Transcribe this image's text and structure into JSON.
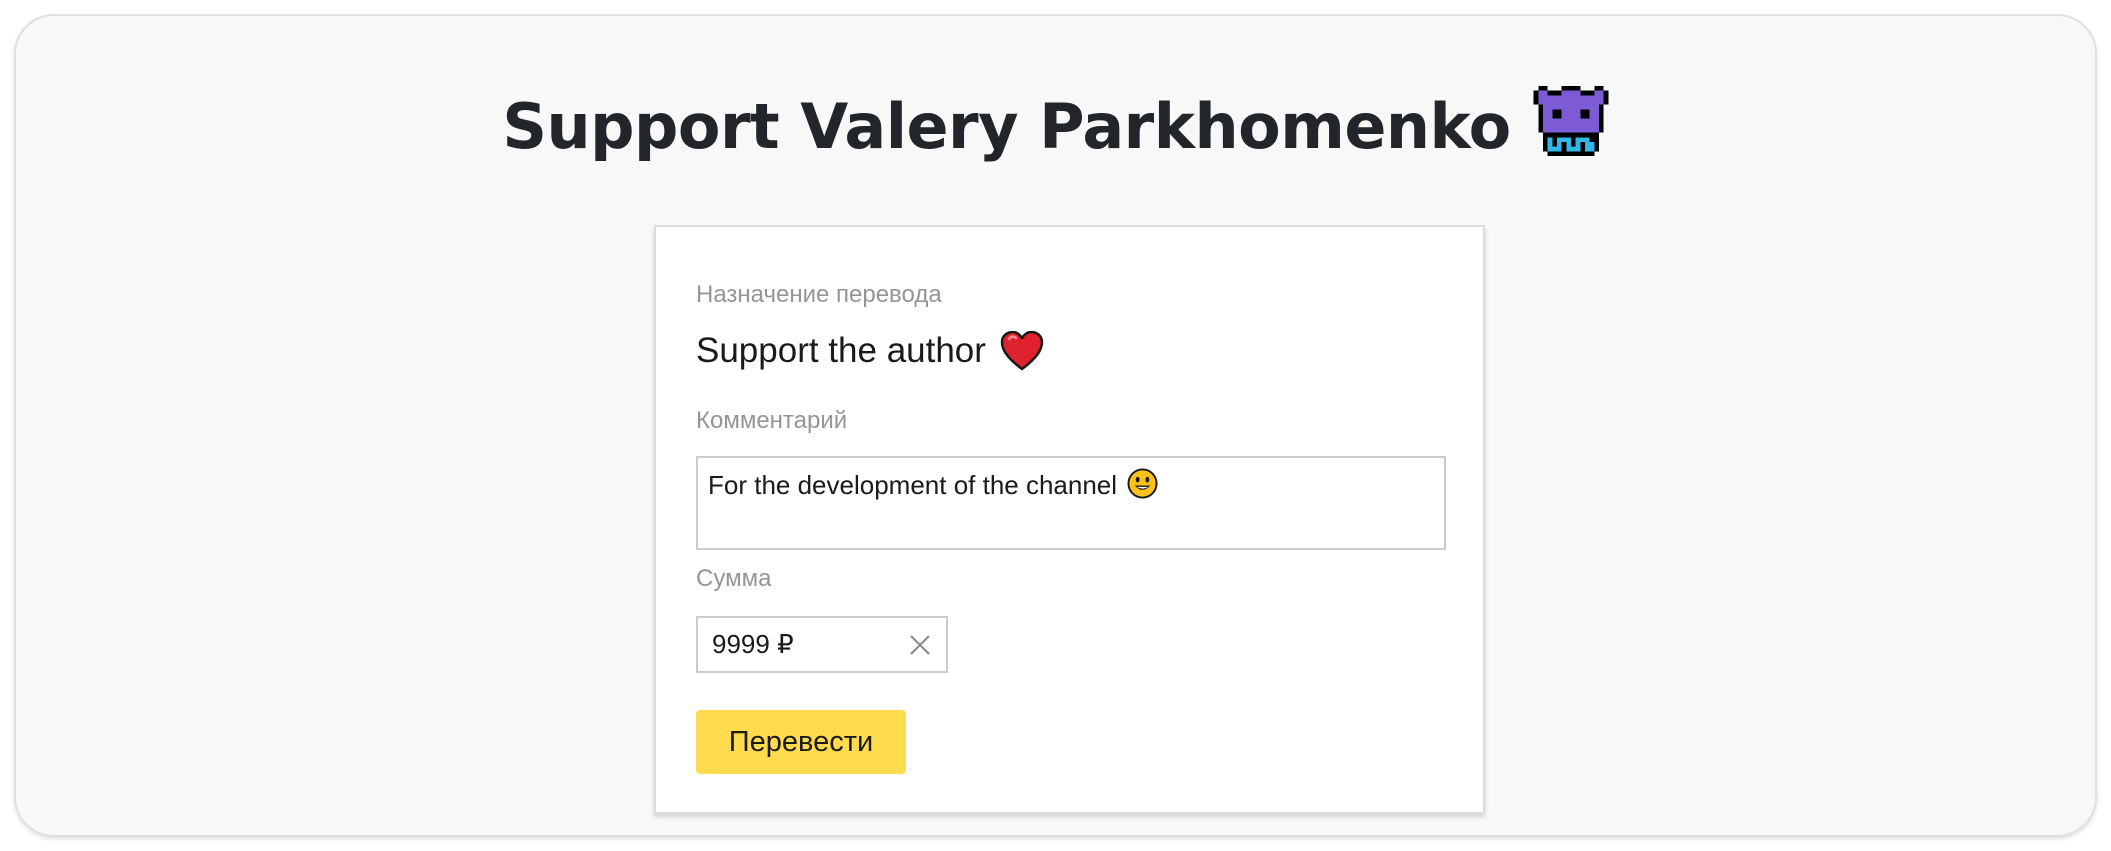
{
  "page": {
    "title": "Support Valery Parkhomenko"
  },
  "form": {
    "purpose_label": "Назначение перевода",
    "purpose_value": "Support the author",
    "comment_label": "Комментарий",
    "comment_value": "For the development of the channel",
    "amount_label": "Сумма",
    "amount_value": "9999 ₽",
    "submit_label": "Перевести"
  },
  "icons": {
    "title_icon": "alien-monster-icon",
    "purpose_icon": "heart-icon",
    "comment_icon": "smiley-icon",
    "clear_icon": "close-icon"
  },
  "colors": {
    "accent": "#ffdb4d",
    "heart": "#e0222e",
    "monster": "#7d5bd4"
  }
}
